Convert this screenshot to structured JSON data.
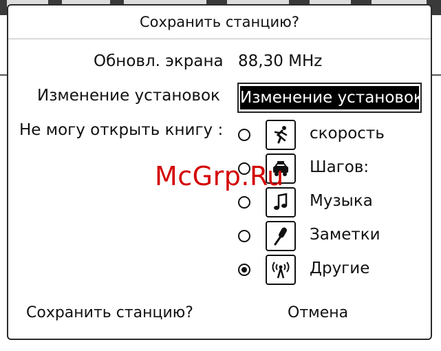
{
  "dialog": {
    "title": "Сохранить станцию?",
    "frequency_label": "Обновл. экрана",
    "frequency_value": "88,30 MHz",
    "name_label": "Изменение установок",
    "name_value": "Изменение установок",
    "category_label": "Не могу открыть книгу :",
    "categories": [
      {
        "label": "скорость",
        "icon": "runner-icon",
        "checked": false
      },
      {
        "label": "Шагов:",
        "icon": "car-icon",
        "checked": false
      },
      {
        "label": "Музыка",
        "icon": "music-note-icon",
        "checked": false
      },
      {
        "label": "Заметки",
        "icon": "microphone-icon",
        "checked": false
      },
      {
        "label": "Другие",
        "icon": "antenna-icon",
        "checked": true
      }
    ],
    "save_label": "Сохранить станцию?",
    "cancel_label": "Отмена"
  },
  "watermark": "McGrp.Ru"
}
